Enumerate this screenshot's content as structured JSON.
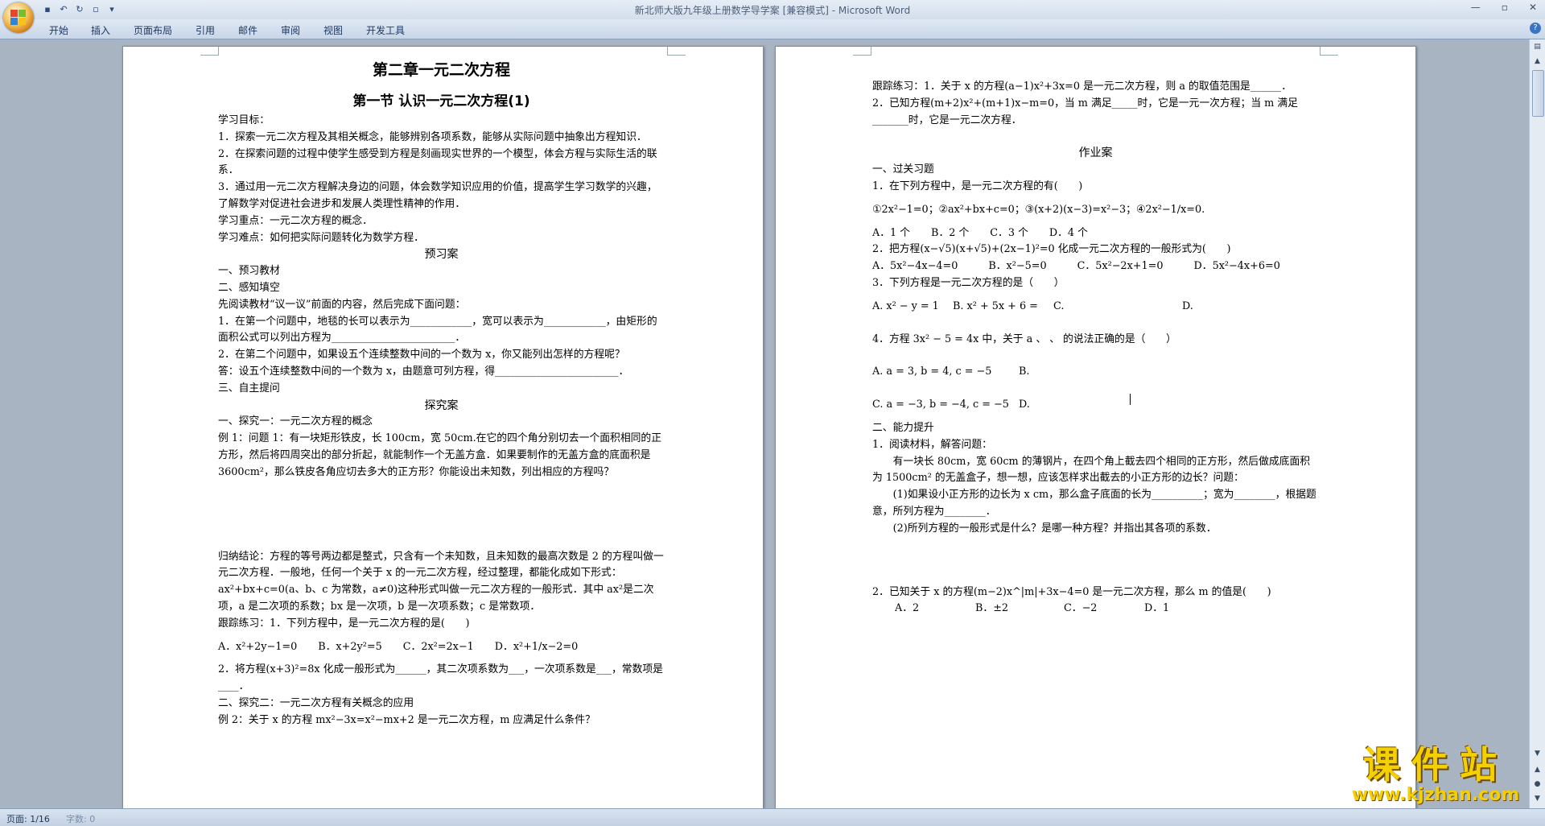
{
  "window": {
    "title": "新北师大版九年级上册数学导学案 [兼容模式] - Microsoft Word"
  },
  "ribbon": {
    "tabs": [
      "开始",
      "插入",
      "页面布局",
      "引用",
      "邮件",
      "审阅",
      "视图",
      "开发工具"
    ]
  },
  "page1": {
    "chapter_title": "第二章一元二次方程",
    "section_title": "第一节 认识一元二次方程(1)",
    "lines_a": [
      "学习目标：",
      "1．探索一元二次方程及其相关概念，能够辨别各项系数，能够从实际问题中抽象出方程知识．",
      "2．在探索问题的过程中使学生感受到方程是刻画现实世界的一个模型，体会方程与实际生活的联系．",
      "3．通过用一元二次方程解决身边的问题，体会数学知识应用的价值，提高学生学习数学的兴趣，了解数学对促进社会进步和发展人类理性精神的作用．",
      "学习重点：一元二次方程的概念．",
      "学习难点：如何把实际问题转化为数学方程．"
    ],
    "heading_preview": "预习案",
    "lines_b": [
      "一、预习教材",
      "二、感知填空",
      "先阅读教材“议一议”前面的内容，然后完成下面问题：",
      "1．在第一个问题中，地毯的长可以表示为____________，宽可以表示为____________，由矩形的面积公式可以列出方程为________________________．",
      "2．在第二个问题中，如果设五个连续整数中间的一个数为 x，你又能列出怎样的方程呢？",
      "答：设五个连续整数中间的一个数为 x，由题意可列方程，得________________________．",
      "三、自主提问"
    ],
    "heading_explore": "探究案",
    "lines_c": [
      "一、探究一：一元二次方程的概念",
      "例 1：问题 1：有一块矩形铁皮，长 100cm，宽 50cm.在它的四个角分别切去一个面积相同的正方形，然后将四周突出的部分折起，就能制作一个无盖方盒．如果要制作的无盖方盒的底面积是 3600cm²，那么铁皮各角应切去多大的正方形？你能设出未知数，列出相应的方程吗？"
    ],
    "lines_d": [
      "归纳结论：方程的等号两边都是整式，只含有一个未知数，且未知数的最高次数是 2 的方程叫做一元二次方程．一般地，任何一个关于 x 的一元二次方程，经过整理，都能化成如下形式：ax²+bx+c=0(a、b、c 为常数，a≠0)这种形式叫做一元二次方程的一般形式．其中 ax²是二次项，a 是二次项的系数；bx 是一次项，b 是一次项系数；c 是常数项．",
      "跟踪练习：1．下列方程中，是一元二次方程的是(　　)"
    ],
    "q1_options": [
      "A．x²+2y−1=0",
      "B．x+2y²=5",
      "C．2x²=2x−1",
      "D．x²+1/x−2=0"
    ],
    "lines_e": [
      "2．将方程(x+3)²=8x 化成一般形式为______，其二次项系数为___，一次项系数是___，常数项是____．",
      "二、探究二：一元二次方程有关概念的应用",
      "例 2：关于 x 的方程 mx²−3x=x²−mx+2 是一元二次方程，m 应满足什么条件？"
    ]
  },
  "page2": {
    "lines_a": [
      "跟踪练习：1．关于 x 的方程(a−1)x²+3x=0 是一元二次方程，则 a 的取值范围是______．",
      "2．已知方程(m+2)x²+(m+1)x−m=0，当 m 满足_____时，它是一元一次方程；当 m 满足_______时，它是一元二次方程．"
    ],
    "heading_homework": "作业案",
    "lines_b": [
      "一、过关习题",
      "1．在下列方程中，是一元二次方程的有(　　)",
      "①2x²−1=0；②ax²+bx+c=0；③(x+2)(x−3)=x²−3；④2x²−1/x=0."
    ],
    "q1_options": [
      "A．1 个",
      "B．2 个",
      "C．3 个",
      "D．4 个"
    ],
    "lines_c": [
      "2．把方程(x−√5)(x+√5)+(2x−1)²=0 化成一元二次方程的一般形式为(　　)"
    ],
    "q2_options": [
      "A．5x²−4x−4=0",
      "B．x²−5=0",
      "C．5x²−2x+1=0",
      "D．5x²−4x+6=0"
    ],
    "lines_d": [
      "3．下列方程是一元二次方程的是（　　）"
    ],
    "q3_options": [
      "A. x² − y = 1",
      "B. x² + 5x + 6 =",
      "C.",
      "D."
    ],
    "lines_e": [
      "4．方程 3x² − 5 = 4x 中，关于 a 、 、 的说法正确的是（　　）"
    ],
    "q4_line1": [
      "A. a = 3, b = 4, c = −5",
      "B."
    ],
    "q4_line2": [
      "C. a = −3, b = −4, c = −5",
      "D."
    ],
    "lines_f": [
      "二、能力提升",
      "1．阅读材料，解答问题：",
      "　　有一块长 80cm，宽 60cm 的薄钢片，在四个角上截去四个相同的正方形，然后做成底面积为 1500cm² 的无盖盒子，想一想，应该怎样求出截去的小正方形的边长？问题：",
      "　　(1)如果设小正方形的边长为 x cm，那么盒子底面的长为__________；宽为________，根据题意，所列方程为________．",
      "　　(2)所列方程的一般形式是什么？是哪一种方程？并指出其各项的系数．"
    ],
    "lines_g": [
      "2．已知关于 x 的方程(m−2)x^|m|+3x−4=0 是一元二次方程，那么 m 的值是(　　)"
    ],
    "q5_options": [
      "A．2",
      "B．±2",
      "C．−2",
      "D．1"
    ]
  },
  "status": {
    "page": "页面: 1/16",
    "words": "字数: 0"
  },
  "watermark": {
    "main": "课件站",
    "url": "www.kjzhan.com"
  }
}
